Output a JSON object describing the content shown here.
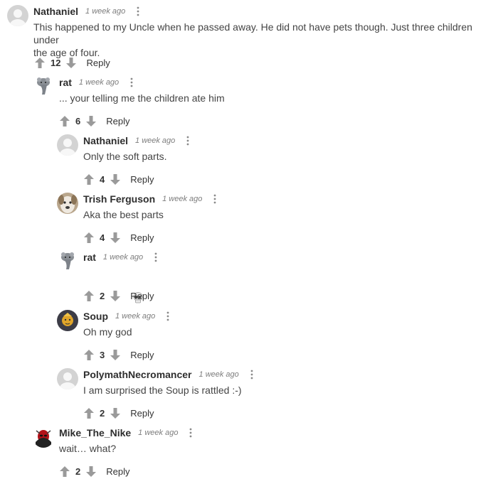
{
  "colors": {
    "text": "#444444",
    "name": "#2e2e2e",
    "meta": "#7d7d7d",
    "icon": "#9a9a9a",
    "default_avatar": "#cfcfcf"
  },
  "comments": [
    {
      "author": "Nathaniel",
      "time": "1 week ago",
      "avatar": "default-avatar",
      "text": "This happened to my Uncle when he passed away. He did not have pets though. Just three children under\nthe age of four.",
      "votes": "12",
      "reply_label": "Reply"
    },
    {
      "author": "rat",
      "time": "1 week ago",
      "avatar": "rat-avatar",
      "text": "... your telling me the children ate him",
      "votes": "6",
      "reply_label": "Reply"
    },
    {
      "author": "Nathaniel",
      "time": "1 week ago",
      "avatar": "default-avatar",
      "text": "Only the soft parts.",
      "votes": "4",
      "reply_label": "Reply"
    },
    {
      "author": "Trish Ferguson",
      "time": "1 week ago",
      "avatar": "dog-avatar",
      "text": "Aka the best parts",
      "votes": "4",
      "reply_label": "Reply"
    },
    {
      "author": "rat",
      "time": "1 week ago",
      "avatar": "rat-avatar",
      "text": "💀",
      "votes": "2",
      "reply_label": "Reply"
    },
    {
      "author": "Soup",
      "time": "1 week ago",
      "avatar": "soup-avatar",
      "text": "Oh my god",
      "votes": "3",
      "reply_label": "Reply"
    },
    {
      "author": "PolymathNecromancer",
      "time": "1 week ago",
      "avatar": "default-avatar",
      "text": "I am surprised the Soup is rattled :-)",
      "votes": "2",
      "reply_label": "Reply"
    },
    {
      "author": "Mike_The_Nike",
      "time": "1 week ago",
      "avatar": "mike-avatar",
      "text": "wait… what?",
      "votes": "2",
      "reply_label": "Reply"
    }
  ]
}
